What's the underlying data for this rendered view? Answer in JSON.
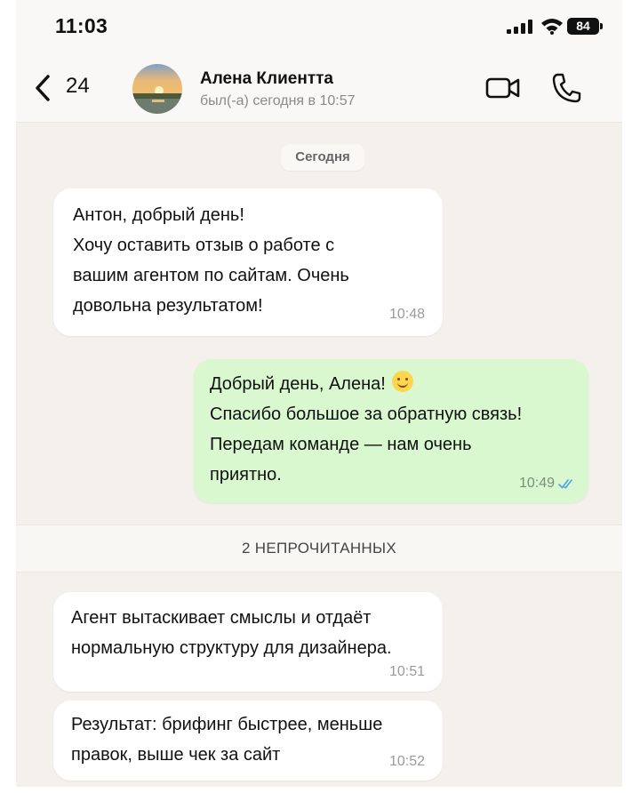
{
  "status_bar": {
    "time": "11:03",
    "battery": "84",
    "signal_icon": "cellular-signal-icon",
    "wifi_icon": "wifi-icon"
  },
  "header": {
    "back_count": "24",
    "contact_name": "Алена Клиентта",
    "last_seen": "был(-а) сегодня в 10:57",
    "icons": {
      "back": "chevron-left-icon",
      "video": "video-camera-icon",
      "call": "phone-icon"
    }
  },
  "chat": {
    "day_separator": "Сегодня",
    "unread_label": "2 НЕПРОЧИТАННЫХ",
    "messages": [
      {
        "direction": "incoming",
        "text": "Антон, добрый день!\nХочу оставить отзыв о работе с\nвашим агентом по сайтам. Очень\nдовольна результатом!",
        "time": "10:48"
      },
      {
        "direction": "outgoing",
        "text_line1": "Добрый день, Алена!",
        "emoji": "smiling-face-emoji",
        "text_rest": "Спасибо большое за обратную связь!\nПередам команде — нам очень\nприятно.",
        "time": "10:49",
        "read_status": "double-check-read-icon"
      },
      {
        "direction": "incoming",
        "text": "Агент вытаскивает смыслы и отдаёт\nнормальную структуру для дизайнера.",
        "time": "10:51"
      },
      {
        "direction": "incoming",
        "text": "Результат: брифинг быстрее, меньше\nправок, выше чек за сайт",
        "time": "10:52"
      }
    ]
  },
  "colors": {
    "chat_background": "#f4f1ec",
    "incoming_bubble": "#ffffff",
    "outgoing_bubble": "#d9f8cf",
    "read_tick": "#4aa3e8"
  }
}
